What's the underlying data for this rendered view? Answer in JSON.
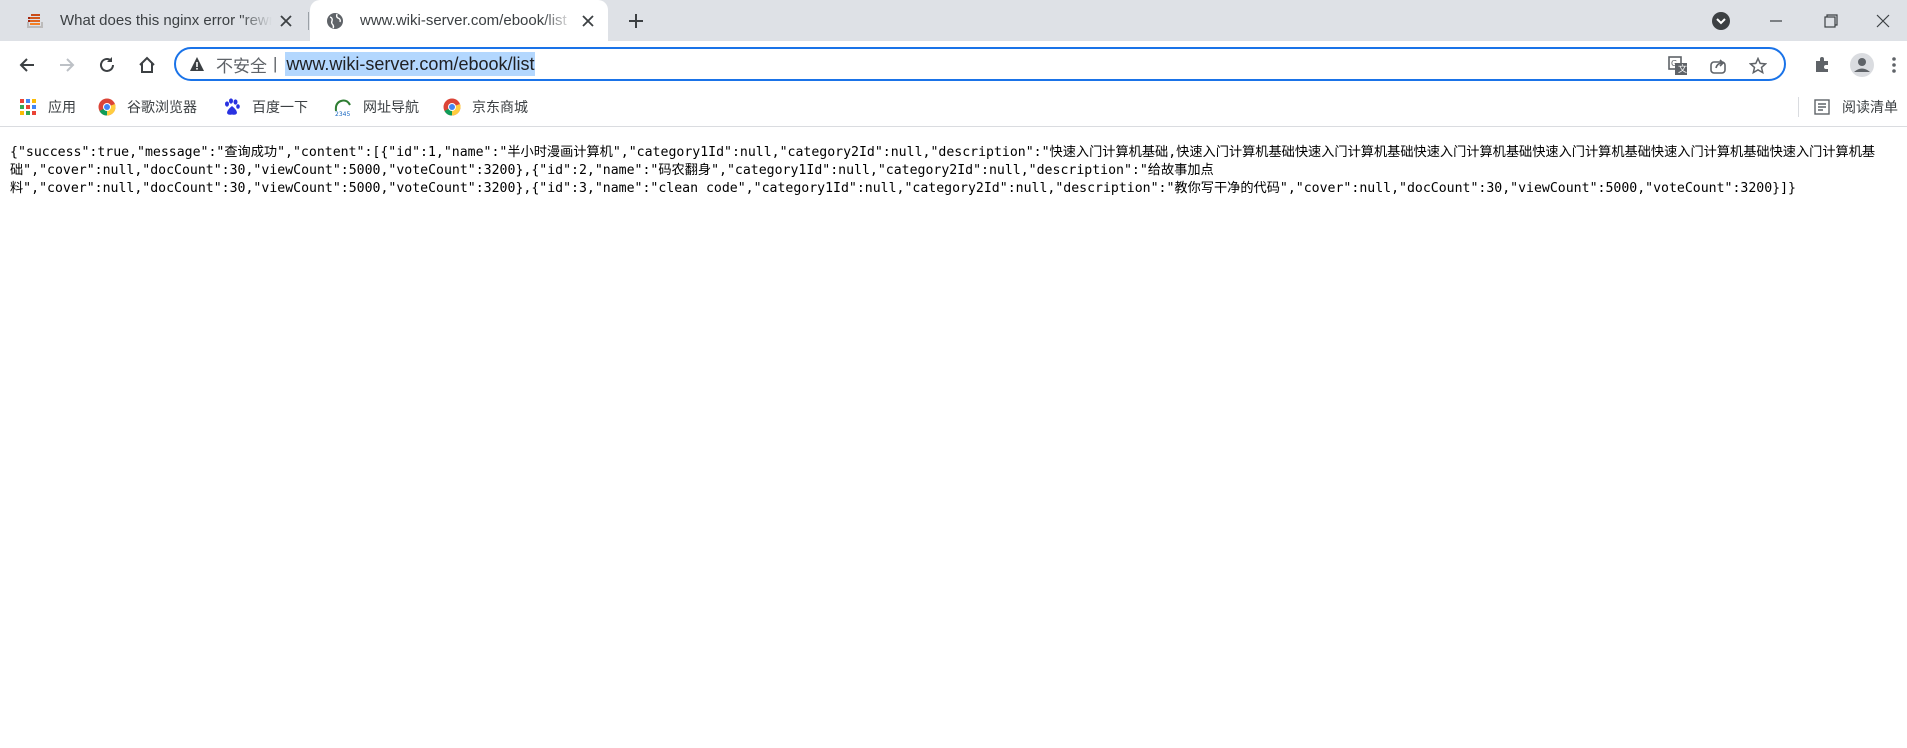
{
  "tabs": [
    {
      "title": "What does this nginx error \"rewrite or internal redirection cycle\" mean?",
      "icon": "stackoverflow-icon",
      "active": false
    },
    {
      "title": "www.wiki-server.com/ebook/list",
      "icon": "globe-icon",
      "active": true
    }
  ],
  "toolbar": {
    "security_label": "不安全",
    "separator": "|",
    "url": "www.wiki-server.com/ebook/list"
  },
  "bookmarks": {
    "items": [
      {
        "label": "应用",
        "icon": "apps-grid-icon"
      },
      {
        "label": "谷歌浏览器",
        "icon": "chrome-icon"
      },
      {
        "label": "百度一下",
        "icon": "baidu-paw-icon"
      },
      {
        "label": "网址导航",
        "icon": "hao123-icon"
      },
      {
        "label": "京东商城",
        "icon": "chrome-icon"
      }
    ],
    "reading_list": "阅读清单"
  },
  "page": {
    "raw_json": "{\"success\":true,\"message\":\"查询成功\",\"content\":[{\"id\":1,\"name\":\"半小时漫画计算机\",\"category1Id\":null,\"category2Id\":null,\"description\":\"快速入门计算机基础,快速入门计算机基础快速入门计算机基础快速入门计算机基础快速入门计算机基础快速入门计算机基础快速入门计算机基础\",\"cover\":null,\"docCount\":30,\"viewCount\":5000,\"voteCount\":3200},{\"id\":2,\"name\":\"码农翻身\",\"category1Id\":null,\"category2Id\":null,\"description\":\"给故事加点\n料\",\"cover\":null,\"docCount\":30,\"viewCount\":5000,\"voteCount\":3200},{\"id\":3,\"name\":\"clean code\",\"category1Id\":null,\"category2Id\":null,\"description\":\"教你写干净的代码\",\"cover\":null,\"docCount\":30,\"viewCount\":5000,\"voteCount\":3200}]}"
  },
  "colors": {
    "tabstrip_bg": "#dee1e6",
    "omnibox_border": "#1a73e8",
    "url_selection": "#b3d7fe"
  }
}
